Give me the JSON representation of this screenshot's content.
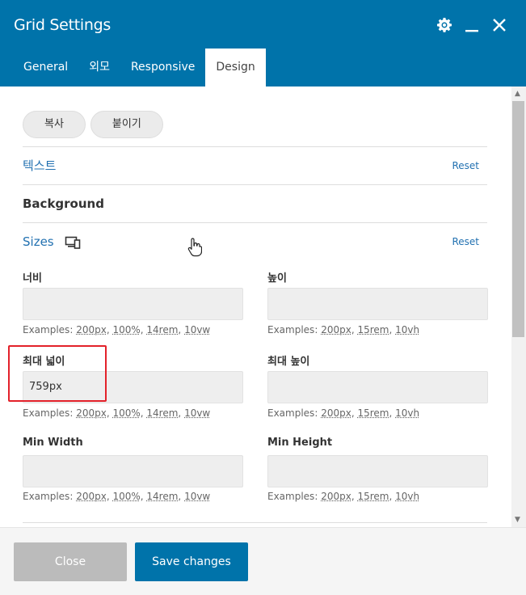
{
  "window": {
    "title": "Grid Settings"
  },
  "header_icons": [
    "gear-icon",
    "minimize-icon",
    "close-icon"
  ],
  "tabs": [
    {
      "label": "General",
      "active": false
    },
    {
      "label": "외모",
      "active": false
    },
    {
      "label": "Responsive",
      "active": false
    },
    {
      "label": "Design",
      "active": true
    }
  ],
  "toolbar": {
    "copy_label": "복사",
    "paste_label": "붙이기"
  },
  "sections": {
    "text": {
      "title": "텍스트",
      "reset": "Reset"
    },
    "background": {
      "title": "Background"
    },
    "sizes": {
      "title": "Sizes",
      "reset": "Reset"
    }
  },
  "fields": {
    "width": {
      "label": "너비",
      "value": "",
      "examples_prefix": "Examples:",
      "examples": [
        "200px",
        "100%",
        "14rem",
        "10vw"
      ]
    },
    "height": {
      "label": "높이",
      "value": "",
      "examples_prefix": "Examples:",
      "examples": [
        "200px",
        "15rem",
        "10vh"
      ]
    },
    "max_width": {
      "label": "최대 넓이",
      "value": "759px",
      "examples_prefix": "Examples:",
      "examples": [
        "200px",
        "100%",
        "14rem",
        "10vw"
      ]
    },
    "max_height": {
      "label": "최대 높이",
      "value": "",
      "examples_prefix": "Examples:",
      "examples": [
        "200px",
        "15rem",
        "10vh"
      ]
    },
    "min_width": {
      "label": "Min Width",
      "value": "",
      "examples_prefix": "Examples:",
      "examples": [
        "200px",
        "100%",
        "14rem",
        "10vw"
      ]
    },
    "min_height": {
      "label": "Min Height",
      "value": "",
      "examples_prefix": "Examples:",
      "examples": [
        "200px",
        "15rem",
        "10vh"
      ]
    }
  },
  "footer": {
    "close_label": "Close",
    "save_label": "Save changes"
  },
  "colors": {
    "header": "#0073aa",
    "link": "#2271b1",
    "highlight": "#e3212a",
    "close_button": "#bbbbbb"
  }
}
